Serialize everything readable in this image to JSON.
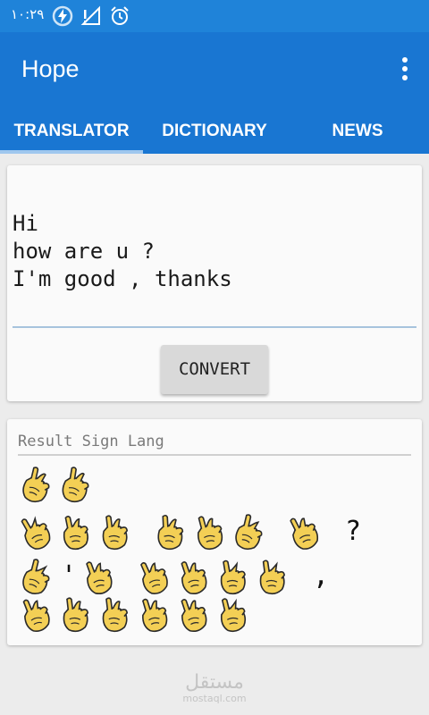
{
  "status_bar": {
    "time": "١٠:٢٩",
    "icons": [
      "battery-charging-icon",
      "signal-icon",
      "alarm-icon"
    ]
  },
  "app_bar": {
    "title": "Hope",
    "overflow_icon": "more-vert-icon"
  },
  "tabs": [
    {
      "label": "TRANSLATOR",
      "selected": true
    },
    {
      "label": "DICTIONARY",
      "selected": false
    },
    {
      "label": "NEWS",
      "selected": false
    }
  ],
  "input": {
    "lines": [
      "Hi",
      "how are u ?",
      "I'm good , thanks"
    ]
  },
  "convert_button": {
    "label": "CONVERT"
  },
  "result": {
    "label": "Result Sign Lang",
    "rows": [
      [
        {
          "type": "hand",
          "letter": "h"
        },
        {
          "type": "hand",
          "letter": "i"
        }
      ],
      [
        {
          "type": "hand",
          "letter": "h"
        },
        {
          "type": "hand",
          "letter": "o"
        },
        {
          "type": "hand",
          "letter": "w"
        },
        {
          "type": "space"
        },
        {
          "type": "hand",
          "letter": "a"
        },
        {
          "type": "hand",
          "letter": "r"
        },
        {
          "type": "hand",
          "letter": "e"
        },
        {
          "type": "space"
        },
        {
          "type": "hand",
          "letter": "u"
        },
        {
          "type": "space"
        },
        {
          "type": "char",
          "text": "?"
        }
      ],
      [
        {
          "type": "hand",
          "letter": "i"
        },
        {
          "type": "char",
          "text": "'"
        },
        {
          "type": "hand",
          "letter": "m"
        },
        {
          "type": "space"
        },
        {
          "type": "hand",
          "letter": "g"
        },
        {
          "type": "hand",
          "letter": "o"
        },
        {
          "type": "hand",
          "letter": "o"
        },
        {
          "type": "hand",
          "letter": "d"
        },
        {
          "type": "space"
        },
        {
          "type": "char",
          "text": ","
        },
        {
          "type": "space"
        }
      ],
      [
        {
          "type": "hand",
          "letter": "t"
        },
        {
          "type": "hand",
          "letter": "h"
        },
        {
          "type": "hand",
          "letter": "a"
        },
        {
          "type": "hand",
          "letter": "n"
        },
        {
          "type": "hand",
          "letter": "k"
        },
        {
          "type": "hand",
          "letter": "s"
        }
      ]
    ]
  },
  "watermark": {
    "main": "مستقل",
    "sub": "mostaql.com"
  },
  "colors": {
    "status_bar": "#1f83d9",
    "app_bar": "#1976d2",
    "hand_fill": "#f3cf55",
    "hand_stroke": "#2a2a2a"
  }
}
